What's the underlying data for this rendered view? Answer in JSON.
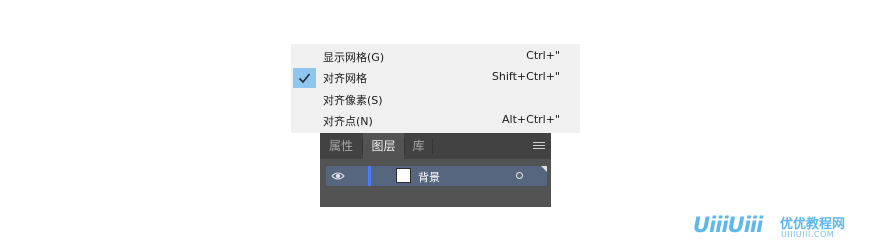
{
  "menu": {
    "items": [
      {
        "label": "显示网格(G)",
        "shortcut": "Ctrl+\"",
        "checked": false
      },
      {
        "label": "对齐网格",
        "shortcut": "Shift+Ctrl+\"",
        "checked": true
      },
      {
        "label": "对齐像素(S)",
        "shortcut": "",
        "checked": false
      },
      {
        "label": "对齐点(N)",
        "shortcut": "Alt+Ctrl+\"",
        "checked": false
      }
    ],
    "check_highlight_color": "#8ec6ee"
  },
  "panel": {
    "tabs": [
      {
        "label": "属性",
        "active": false
      },
      {
        "label": "图层",
        "active": true
      },
      {
        "label": "库",
        "active": false
      }
    ],
    "layers": [
      {
        "name": "背景",
        "visible": true,
        "color": "#4a7cff"
      }
    ]
  },
  "watermark": {
    "logo": "UiiiUiii",
    "site_name": "优优教程网",
    "url": "UIIIUIII.COM"
  }
}
